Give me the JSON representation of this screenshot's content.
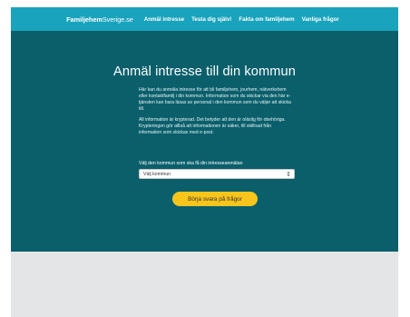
{
  "navbar": {
    "brand_bold": "Familjehem",
    "brand_light": "Sverige.se",
    "links": [
      {
        "label": "Anmäl intresse"
      },
      {
        "label": "Testa dig själv!"
      },
      {
        "label": "Fakta om familjehem"
      },
      {
        "label": "Vanliga frågor"
      }
    ]
  },
  "hero": {
    "title": "Anmäl intresse till din kommun",
    "paragraphs": [
      "Här kan du anmäla intresse för att bli familjehem, jourhem, nätverkshem eller kontaktfamilj i din kommun. Information som du skickar via den här e-tjänsten kan bara läsas av personal i den kommun som du väljer att skicka till.",
      "All information är krypterad. Det betyder att den är oläslig för obehöriga. Krypteringen gör alltså att informationen är säker, till skillnad från information som skickas med e-post."
    ],
    "select_label": "Välj den kommun som ska få din intresseanmälan",
    "select_value": "Välj kommun",
    "cta_label": "Börja svara på frågor"
  },
  "colors": {
    "navbar": "#19a3bc",
    "hero": "#0a5f6b",
    "page": "#e4e5e7",
    "button": "#f7c51b"
  }
}
